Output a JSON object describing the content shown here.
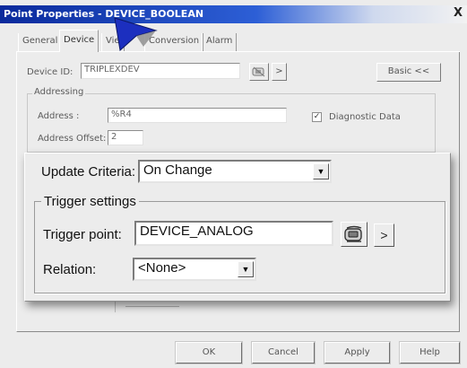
{
  "window": {
    "title": "Point Properties - DEVICE_BOOLEAN",
    "close_glyph": "X"
  },
  "tabs": [
    {
      "label": "General"
    },
    {
      "label": "Device"
    },
    {
      "label": "Vie"
    },
    {
      "label": "Conversion"
    },
    {
      "label": "Alarm"
    }
  ],
  "device": {
    "device_id_label": "Device ID:",
    "device_id_value": "TRIPLEXDEV",
    "more_glyph": ">",
    "basic_button": "Basic <<"
  },
  "addressing": {
    "group_label": "Addressing",
    "address_label": "Address :",
    "address_value": "%R4",
    "offset_label": "Address Offset:",
    "offset_value": "2",
    "diagnostic_label": "Diagnostic Data",
    "diagnostic_checked": true,
    "check_glyph": "✓"
  },
  "overlay": {
    "update_criteria_label": "Update Criteria:",
    "update_criteria_value": "On Change",
    "dropdown_glyph": "▼",
    "trigger_group_label": "Trigger settings",
    "trigger_point_label": "Trigger point:",
    "trigger_point_value": "DEVICE_ANALOG",
    "more_glyph": ">",
    "relation_label": "Relation:",
    "relation_value": "<None>"
  },
  "footer": {
    "ok": "OK",
    "cancel": "Cancel",
    "apply": "Apply",
    "help": "Help"
  }
}
